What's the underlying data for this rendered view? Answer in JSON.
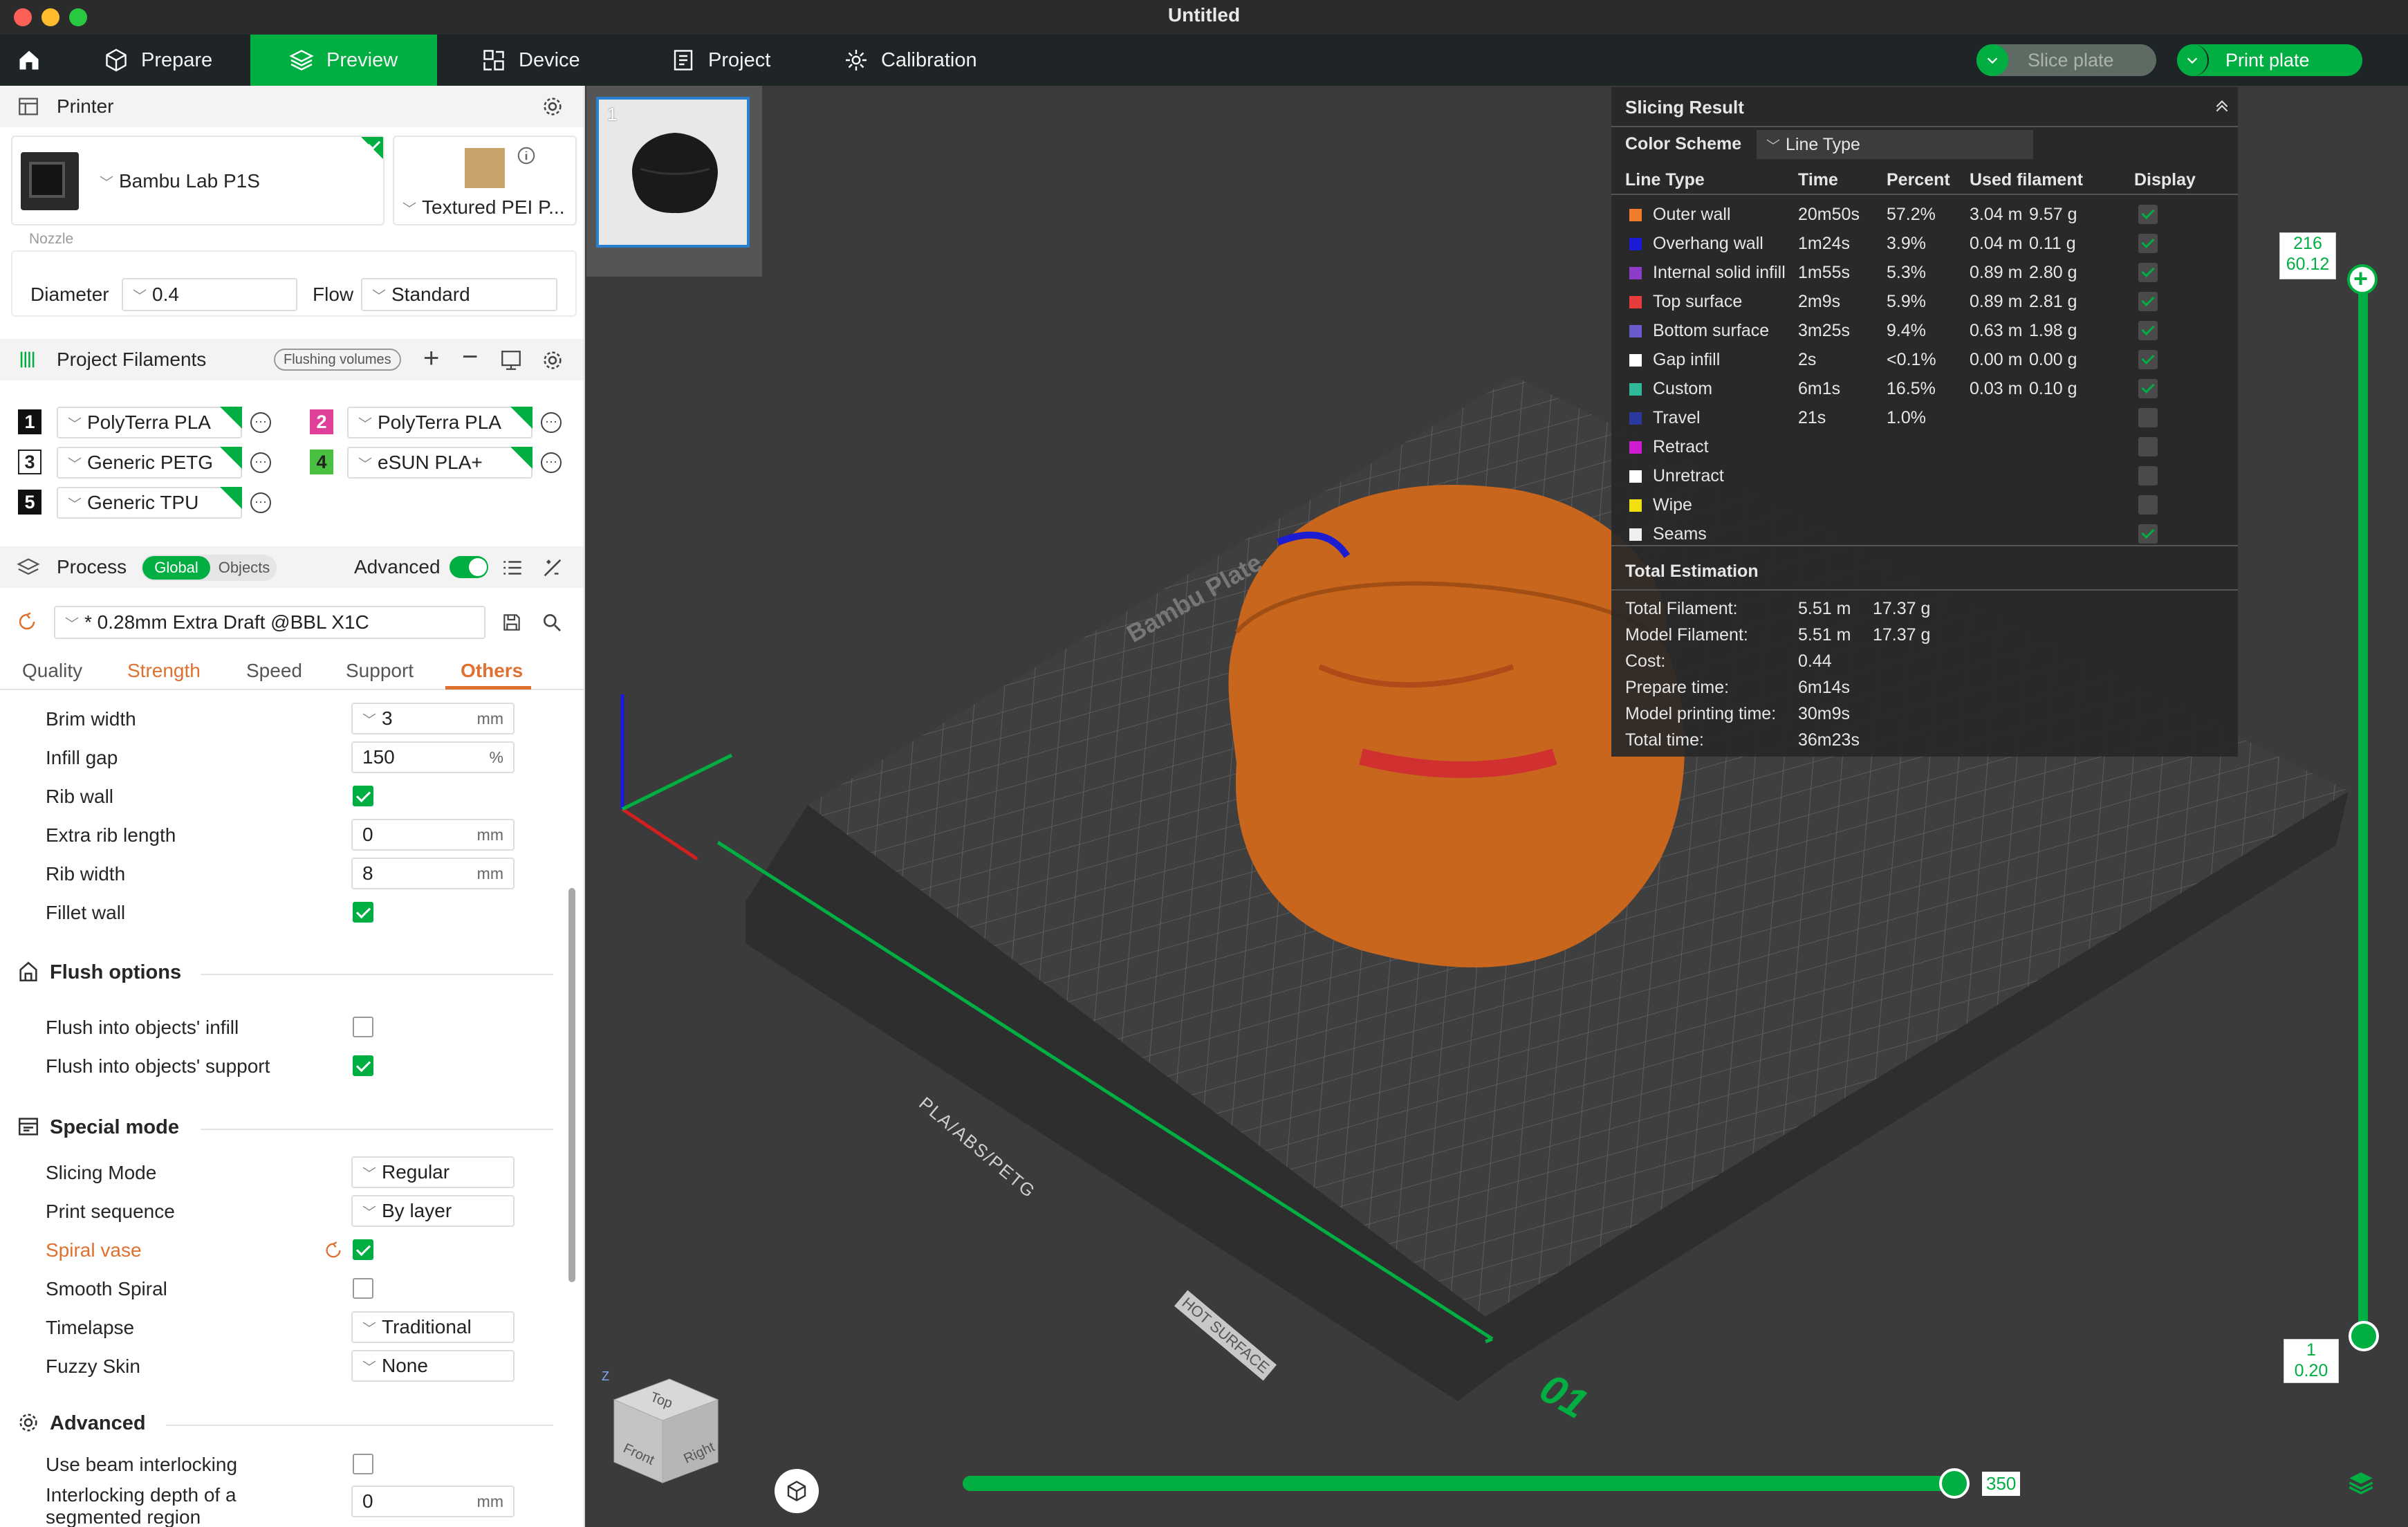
{
  "window": {
    "title": "Untitled"
  },
  "nav": {
    "tabs": [
      {
        "label": "Prepare"
      },
      {
        "label": "Preview"
      },
      {
        "label": "Device"
      },
      {
        "label": "Project"
      },
      {
        "label": "Calibration"
      }
    ],
    "slice_label": "Slice plate",
    "print_label": "Print plate"
  },
  "printer": {
    "section_label": "Printer",
    "name": "Bambu Lab P1S",
    "plate": "Textured PEI P...",
    "nozzle_label": "Nozzle",
    "diameter_label": "Diameter",
    "diameter_value": "0.4",
    "flow_label": "Flow",
    "flow_value": "Standard"
  },
  "filaments": {
    "section_label": "Project Filaments",
    "flushing_label": "Flushing volumes",
    "items": [
      {
        "num": "1",
        "name": "PolyTerra PLA",
        "color": "#111111"
      },
      {
        "num": "2",
        "name": "PolyTerra PLA",
        "color": "#e0409a"
      },
      {
        "num": "3",
        "name": "Generic PETG",
        "color": "#ffffff"
      },
      {
        "num": "4",
        "name": "eSUN PLA+",
        "color": "#4ac040"
      },
      {
        "num": "5",
        "name": "Generic TPU",
        "color": "#111111"
      }
    ]
  },
  "process": {
    "section_label": "Process",
    "global_label": "Global",
    "objects_label": "Objects",
    "advanced_label": "Advanced",
    "preset": "* 0.28mm Extra Draft @BBL X1C",
    "tabs": [
      "Quality",
      "Strength",
      "Speed",
      "Support",
      "Others"
    ],
    "active_tab": "Others"
  },
  "settings": {
    "brim_width": {
      "label": "Brim width",
      "value": "3",
      "unit": "mm"
    },
    "infill_gap": {
      "label": "Infill gap",
      "value": "150",
      "unit": "%"
    },
    "rib_wall": {
      "label": "Rib wall"
    },
    "extra_rib_length": {
      "label": "Extra rib length",
      "value": "0",
      "unit": "mm"
    },
    "rib_width": {
      "label": "Rib width",
      "value": "8",
      "unit": "mm"
    },
    "fillet_wall": {
      "label": "Fillet wall"
    },
    "flush_options_title": "Flush options",
    "flush_infill": {
      "label": "Flush into objects' infill"
    },
    "flush_support": {
      "label": "Flush into objects' support"
    },
    "special_mode_title": "Special mode",
    "slicing_mode": {
      "label": "Slicing Mode",
      "value": "Regular"
    },
    "print_sequence": {
      "label": "Print sequence",
      "value": "By layer"
    },
    "spiral_vase": {
      "label": "Spiral vase"
    },
    "smooth_spiral": {
      "label": "Smooth Spiral"
    },
    "timelapse": {
      "label": "Timelapse",
      "value": "Traditional"
    },
    "fuzzy_skin": {
      "label": "Fuzzy Skin",
      "value": "None"
    },
    "advanced_title": "Advanced",
    "beam_interlocking": {
      "label": "Use beam interlocking"
    },
    "interlocking_depth": {
      "label_1": "Interlocking depth of a",
      "label_2": "segmented region",
      "value": "0",
      "unit": "mm"
    }
  },
  "plate": {
    "thumb_index": "1",
    "label": "PLA/ABS/PETG",
    "hot": "HOT SURFACE",
    "number": "01",
    "name": "Bambu Plate"
  },
  "result": {
    "title": "Slicing Result",
    "color_scheme_label": "Color Scheme",
    "color_scheme_value": "Line Type",
    "headers": [
      "Line Type",
      "Time",
      "Percent",
      "Used filament",
      "Display"
    ],
    "rows": [
      {
        "name": "Outer wall",
        "time": "20m50s",
        "percent": "57.2%",
        "len": "3.04 m",
        "weight": "9.57 g",
        "color": "#f07d2c",
        "on": true
      },
      {
        "name": "Overhang wall",
        "time": "1m24s",
        "percent": "3.9%",
        "len": "0.04 m",
        "weight": "0.11 g",
        "color": "#1c1cd8",
        "on": true
      },
      {
        "name": "Internal solid infill",
        "time": "1m55s",
        "percent": "5.3%",
        "len": "0.89 m",
        "weight": "2.80 g",
        "color": "#8c3cc8",
        "on": true
      },
      {
        "name": "Top surface",
        "time": "2m9s",
        "percent": "5.9%",
        "len": "0.89 m",
        "weight": "2.81 g",
        "color": "#e63c3c",
        "on": true
      },
      {
        "name": "Bottom surface",
        "time": "3m25s",
        "percent": "9.4%",
        "len": "0.63 m",
        "weight": "1.98 g",
        "color": "#6a5ccc",
        "on": true
      },
      {
        "name": "Gap infill",
        "time": "2s",
        "percent": "<0.1%",
        "len": "0.00 m",
        "weight": "0.00 g",
        "color": "#ffffff",
        "on": true
      },
      {
        "name": "Custom",
        "time": "6m1s",
        "percent": "16.5%",
        "len": "0.03 m",
        "weight": "0.10 g",
        "color": "#2fb89a",
        "on": true
      },
      {
        "name": "Travel",
        "time": "21s",
        "percent": "1.0%",
        "len": "",
        "weight": "",
        "color": "#2c3aa0",
        "on": false
      },
      {
        "name": "Retract",
        "time": "",
        "percent": "",
        "len": "",
        "weight": "",
        "color": "#d01cd0",
        "on": false
      },
      {
        "name": "Unretract",
        "time": "",
        "percent": "",
        "len": "",
        "weight": "",
        "color": "#ffffff",
        "on": false
      },
      {
        "name": "Wipe",
        "time": "",
        "percent": "",
        "len": "",
        "weight": "",
        "color": "#f0e010",
        "on": false
      },
      {
        "name": "Seams",
        "time": "",
        "percent": "",
        "len": "",
        "weight": "",
        "color": "#f0f0f0",
        "on": true
      }
    ],
    "total_title": "Total Estimation",
    "totals": [
      {
        "label": "Total Filament:",
        "v1": "5.51 m",
        "v2": "17.37 g"
      },
      {
        "label": "Model Filament:",
        "v1": "5.51 m",
        "v2": "17.37 g"
      },
      {
        "label": "Cost:",
        "v1": "0.44",
        "v2": ""
      },
      {
        "label": "Prepare time:",
        "v1": "6m14s",
        "v2": ""
      },
      {
        "label": "Model printing time:",
        "v1": "30m9s",
        "v2": ""
      },
      {
        "label": "Total time:",
        "v1": "36m23s",
        "v2": ""
      }
    ]
  },
  "sliders": {
    "top_layer": "216",
    "top_height": "60.12",
    "bottom_layer": "1",
    "bottom_height": "0.20",
    "move_value": "350"
  },
  "cube": {
    "top": "Top",
    "front": "Front",
    "right": "Right",
    "z": "Z"
  }
}
